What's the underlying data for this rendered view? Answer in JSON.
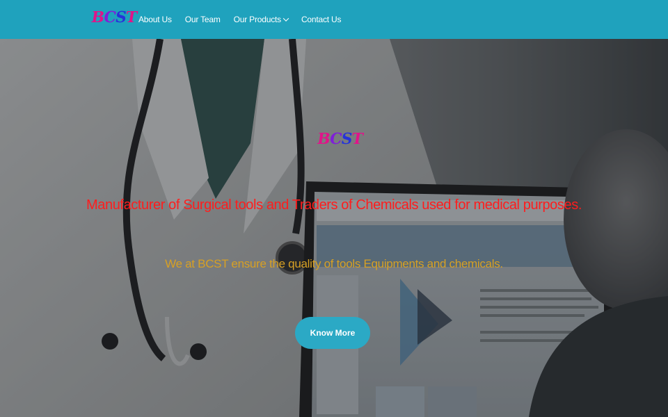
{
  "header": {
    "logo_letters": [
      "B",
      "C",
      "S",
      "T"
    ],
    "nav": [
      {
        "label": "About Us"
      },
      {
        "label": "Our Team"
      },
      {
        "label": "Our Products",
        "dropdown": true
      },
      {
        "label": "Contact Us"
      }
    ],
    "background_color": "#1fa2bd"
  },
  "hero": {
    "logo_letters": [
      "B",
      "C",
      "S",
      "T"
    ],
    "headline": "Manufacturer of Surgical tools and Traders of Chemicals used for medical purposes.",
    "subline": "We at BCST ensure the quality of tools Equipments and chemicals.",
    "cta_label": "Know More",
    "headline_color": "#ff1d1d",
    "subline_color": "#d7a024",
    "cta_color": "#2ba9c5"
  }
}
